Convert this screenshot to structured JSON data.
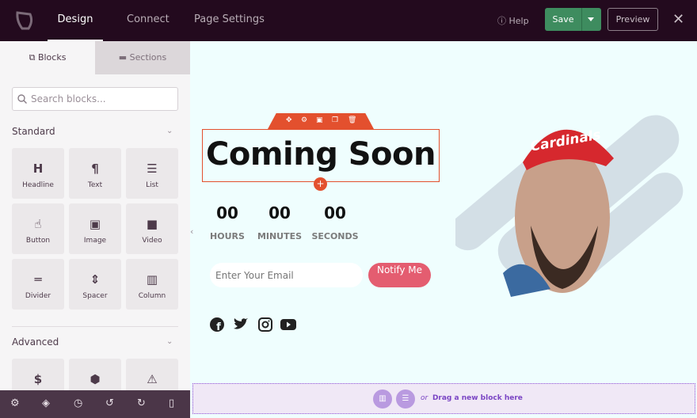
{
  "topbar": {
    "nav": [
      "Design",
      "Connect",
      "Page Settings"
    ],
    "active": "Design",
    "help": "Help",
    "save": "Save",
    "preview": "Preview"
  },
  "sidebar": {
    "tabs": [
      "Blocks",
      "Sections"
    ],
    "search_placeholder": "Search blocks...",
    "standard_title": "Standard",
    "advanced_title": "Advanced",
    "blocks": [
      {
        "label": "Headline",
        "icon": "H"
      },
      {
        "label": "Text",
        "icon": "¶"
      },
      {
        "label": "List",
        "icon": "☰"
      },
      {
        "label": "Button",
        "icon": "☝"
      },
      {
        "label": "Image",
        "icon": "▣"
      },
      {
        "label": "Video",
        "icon": "■"
      },
      {
        "label": "Divider",
        "icon": "═"
      },
      {
        "label": "Spacer",
        "icon": "⇕"
      },
      {
        "label": "Column",
        "icon": "▥"
      }
    ],
    "advanced_icons": [
      "$",
      "⬢",
      "⚠"
    ]
  },
  "canvas": {
    "headline": "Coming Soon",
    "countdown": [
      {
        "value": "00",
        "unit": "HOURS"
      },
      {
        "value": "00",
        "unit": "MINUTES"
      },
      {
        "value": "00",
        "unit": "SECONDS"
      }
    ],
    "email_placeholder": "Enter Your Email",
    "button": "Notify Me",
    "social": [
      "facebook",
      "twitter",
      "instagram",
      "youtube"
    ],
    "cap_text": "Cardinals"
  },
  "dropzone": {
    "or": "or",
    "text": "Drag a new block here"
  },
  "colors": {
    "topbar": "#230a1e",
    "save": "#3e8c5f",
    "accent": "#e3502e",
    "notify": "#e45d70",
    "canvas": "#effefe"
  }
}
